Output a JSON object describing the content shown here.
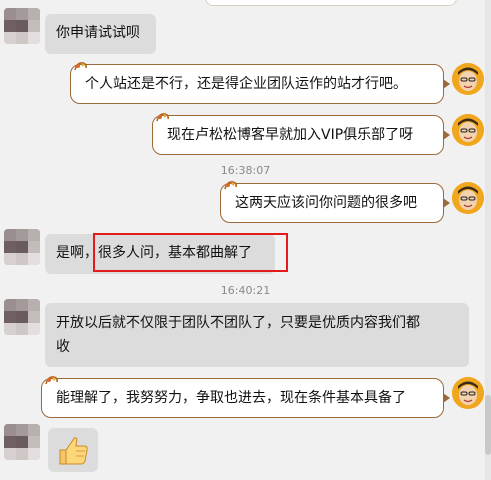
{
  "messages": {
    "m1": {
      "text": "你申请试试呗"
    },
    "m2": {
      "text": "个人站还是不行，还是得企业团队运作的站才行吧。"
    },
    "m3": {
      "text": "现在卢松松博客早就加入VIP俱乐部了呀"
    },
    "m4": {
      "text": "这两天应该问你问题的很多吧"
    },
    "m5": {
      "text": "是啊，很多人问，基本都曲解了"
    },
    "m6": {
      "text_line1": "开放以后就不仅限于团队不团队了，只要是优质内容我们都",
      "text_line2": "收"
    },
    "m7": {
      "text": "能理解了，我努努力，争取也进去，现在条件基本具备了"
    }
  },
  "timestamps": {
    "t1": "16:38:07",
    "t2": "16:40:21"
  },
  "emoji": {
    "thumb": "👍"
  },
  "colors": {
    "left_bubble": "#dcdcdc",
    "right_bubble_border": "#9a6a3a",
    "highlight": "#e31b1b",
    "avatar_right": "#f0a71e"
  }
}
